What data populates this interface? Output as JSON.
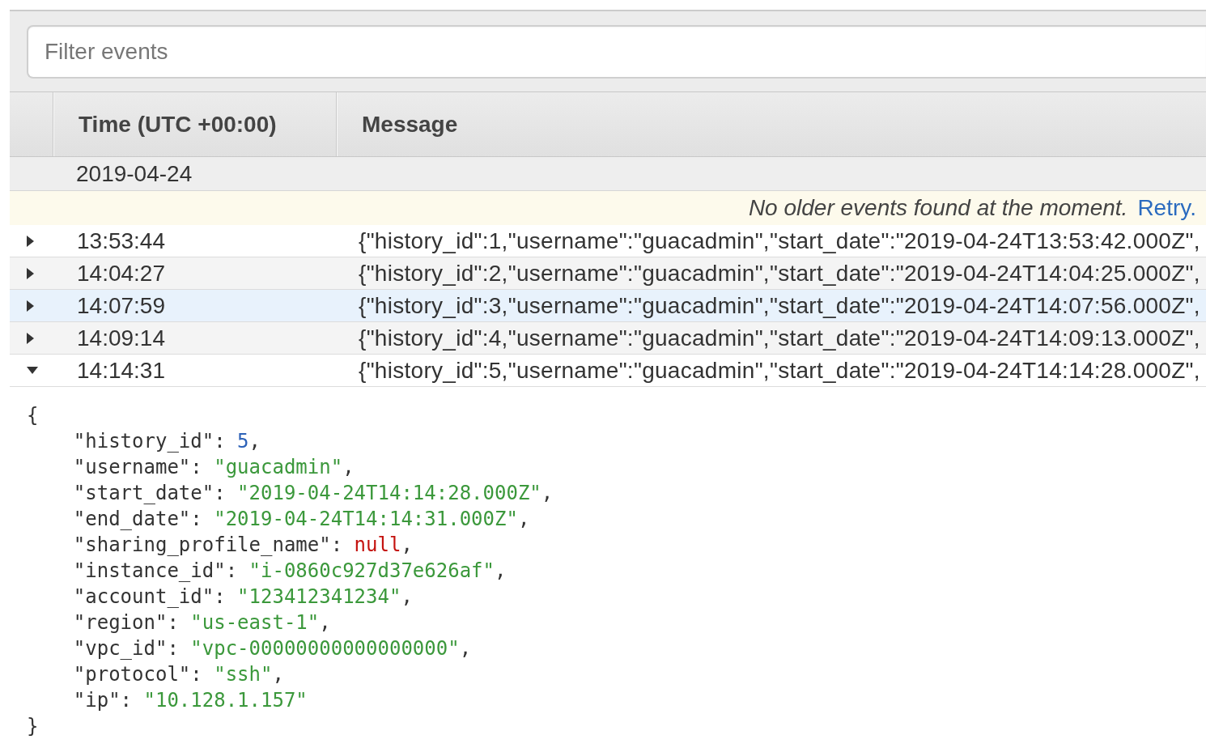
{
  "filter": {
    "placeholder": "Filter events"
  },
  "table": {
    "columns": [
      "Time (UTC +00:00)",
      "Message"
    ],
    "date_group": "2019-04-24",
    "notice": {
      "text": "No older events found at the moment.",
      "link": "Retry."
    },
    "rows": [
      {
        "time": "13:53:44",
        "message": "{\"history_id\":1,\"username\":\"guacadmin\",\"start_date\":\"2019-04-24T13:53:42.000Z\",",
        "expanded": false,
        "highlighted": false
      },
      {
        "time": "14:04:27",
        "message": "{\"history_id\":2,\"username\":\"guacadmin\",\"start_date\":\"2019-04-24T14:04:25.000Z\",",
        "expanded": false,
        "highlighted": false
      },
      {
        "time": "14:07:59",
        "message": "{\"history_id\":3,\"username\":\"guacadmin\",\"start_date\":\"2019-04-24T14:07:56.000Z\",",
        "expanded": false,
        "highlighted": true
      },
      {
        "time": "14:09:14",
        "message": "{\"history_id\":4,\"username\":\"guacadmin\",\"start_date\":\"2019-04-24T14:09:13.000Z\",",
        "expanded": false,
        "highlighted": false
      },
      {
        "time": "14:14:31",
        "message": "{\"history_id\":5,\"username\":\"guacadmin\",\"start_date\":\"2019-04-24T14:14:28.000Z\",",
        "expanded": true,
        "highlighted": false,
        "detail": {
          "open": "{",
          "close": "}",
          "fields": [
            {
              "key": "\"history_id\":",
              "value": "5",
              "kind": "number",
              "suffix": ","
            },
            {
              "key": "\"username\":",
              "value": "\"guacadmin\"",
              "kind": "string",
              "suffix": ","
            },
            {
              "key": "\"start_date\":",
              "value": "\"2019-04-24T14:14:28.000Z\"",
              "kind": "string",
              "suffix": ","
            },
            {
              "key": "\"end_date\":",
              "value": "\"2019-04-24T14:14:31.000Z\"",
              "kind": "string",
              "suffix": ","
            },
            {
              "key": "\"sharing_profile_name\":",
              "value": "null",
              "kind": "null",
              "suffix": ","
            },
            {
              "key": "\"instance_id\":",
              "value": "\"i-0860c927d37e626af\"",
              "kind": "string",
              "suffix": ","
            },
            {
              "key": "\"account_id\":",
              "value": "\"123412341234\"",
              "kind": "string",
              "suffix": ","
            },
            {
              "key": "\"region\":",
              "value": "\"us-east-1\"",
              "kind": "string",
              "suffix": ","
            },
            {
              "key": "\"vpc_id\":",
              "value": "\"vpc-00000000000000000\"",
              "kind": "string",
              "suffix": ","
            },
            {
              "key": "\"protocol\":",
              "value": "\"ssh\"",
              "kind": "string",
              "suffix": ","
            },
            {
              "key": "\"ip\":",
              "value": "\"10.128.1.157\"",
              "kind": "string"
            }
          ]
        }
      }
    ]
  }
}
